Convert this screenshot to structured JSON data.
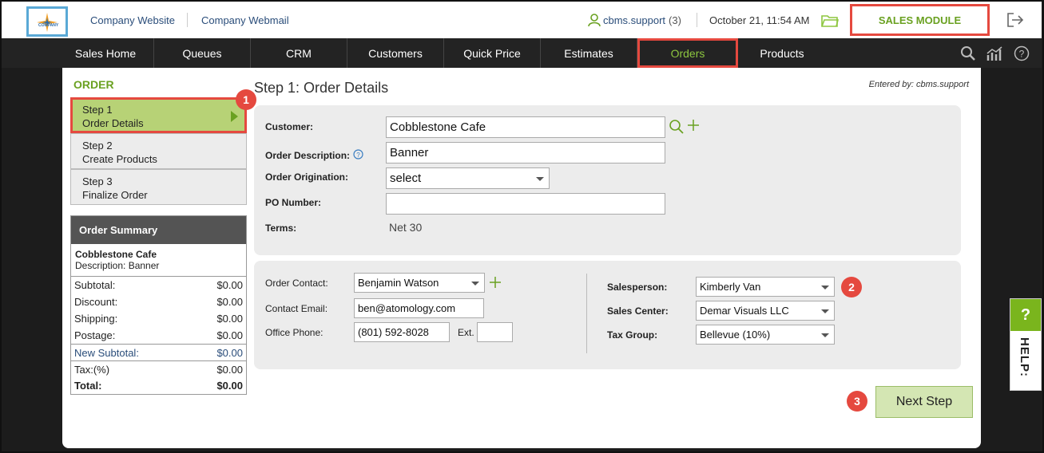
{
  "header": {
    "logo_text": "COMPANY",
    "links": [
      "Company Website",
      "Company Webmail"
    ],
    "user": "cbms.support",
    "user_count": "(3)",
    "datetime": "October 21, 11:54 AM",
    "module": "SALES MODULE",
    "icons": [
      "user-icon",
      "folder-icon",
      "logout-icon"
    ]
  },
  "nav": {
    "items": [
      "Sales Home",
      "Queues",
      "CRM",
      "Customers",
      "Quick Price",
      "Estimates",
      "Orders",
      "Products"
    ],
    "active": "Orders",
    "icons": [
      "search-icon",
      "analytics-icon",
      "help-icon"
    ]
  },
  "sidebar": {
    "title": "ORDER",
    "steps": [
      {
        "num": "Step 1",
        "label": "Order Details"
      },
      {
        "num": "Step 2",
        "label": "Create Products"
      },
      {
        "num": "Step 3",
        "label": "Finalize Order"
      }
    ]
  },
  "summary": {
    "title": "Order Summary",
    "customer": "Cobblestone Cafe",
    "description": "Description:  Banner",
    "rows": [
      {
        "label": "Subtotal:",
        "value": "$0.00"
      },
      {
        "label": "Discount:",
        "value": "$0.00"
      },
      {
        "label": "Shipping:",
        "value": "$0.00"
      },
      {
        "label": "Postage:",
        "value": "$0.00"
      },
      {
        "label": "New Subtotal:",
        "value": "$0.00"
      },
      {
        "label": "Tax:(%)",
        "value": "$0.00"
      },
      {
        "label": "Total:",
        "value": "$0.00"
      }
    ]
  },
  "main": {
    "title": "Step 1: Order Details",
    "entered_by": "Entered by: cbms.support",
    "customer_label": "Customer:",
    "customer_value": "Cobblestone Cafe",
    "desc_label": "Order Description:",
    "desc_value": "Banner",
    "origination_label": "Order Origination:",
    "origination_value": "select",
    "po_label": "PO Number:",
    "po_value": "",
    "terms_label": "Terms:",
    "terms_value": "Net 30",
    "contact_label": "Order Contact:",
    "contact_value": "Benjamin Watson",
    "email_label": "Contact Email:",
    "email_value": "ben@atomology.com",
    "phone_label": "Office Phone:",
    "phone_value": "(801) 592-8028",
    "ext_label": "Ext.",
    "ext_value": "",
    "salesperson_label": "Salesperson:",
    "salesperson_value": "Kimberly Van",
    "center_label": "Sales Center:",
    "center_value": "Demar Visuals LLC",
    "tax_label": "Tax Group:",
    "tax_value": "Bellevue (10%)",
    "next_button": "Next Step"
  },
  "badges": [
    "1",
    "2",
    "3"
  ],
  "help": {
    "q": "?",
    "label": "HELP:"
  },
  "colors": {
    "accent_green": "#6aa121",
    "highlight_red": "#e5493f",
    "nav_bg": "#232323"
  }
}
